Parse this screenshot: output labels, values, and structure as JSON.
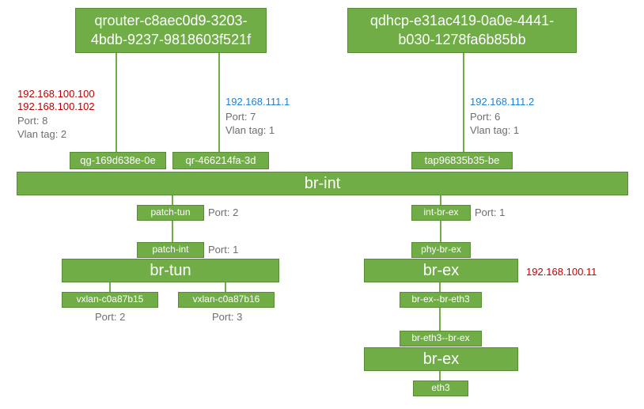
{
  "namespaces": {
    "qrouter": "qrouter-c8aec0d9-3203-4bdb-9237-9818603f521f",
    "qdhcp": "qdhcp-e31ac419-0a0e-4441-b030-1278fa6b85bb"
  },
  "interfaces": {
    "qg": {
      "name": "qg-169d638e-0e",
      "ips": [
        "192.168.100.100",
        "192.168.100.102"
      ],
      "port_label": "Port: 8",
      "vlan_label": "Vlan tag: 2"
    },
    "qr": {
      "name": "qr-466214fa-3d",
      "ips": [
        "192.168.111.1"
      ],
      "port_label": "Port: 7",
      "vlan_label": "Vlan tag: 1"
    },
    "tap": {
      "name": "tap96835b35-be",
      "ips": [
        "192.168.111.2"
      ],
      "port_label": "Port: 6",
      "vlan_label": "Vlan tag: 1"
    }
  },
  "bridges": {
    "br_int": "br-int",
    "br_tun": "br-tun",
    "br_ex1": "br-ex",
    "br_ex2": "br-ex",
    "patch_tun": "patch-tun",
    "patch_int": "patch-int",
    "int_br_ex": "int-br-ex",
    "phy_br_ex": "phy-br-ex",
    "br_ex_br_eth3": "br-ex--br-eth3",
    "br_eth3_br_ex": "br-eth3--br-ex",
    "vxlan1": "vxlan-c0a87b15",
    "vxlan2": "vxlan-c0a87b16",
    "eth3": "eth3"
  },
  "ports": {
    "patch_tun": "Port: 2",
    "patch_int": "Port: 1",
    "int_br_ex": "Port: 1",
    "vxlan1": "Port: 2",
    "vxlan2": "Port: 3"
  },
  "extra": {
    "ext_ip": "192.168.100.11"
  }
}
